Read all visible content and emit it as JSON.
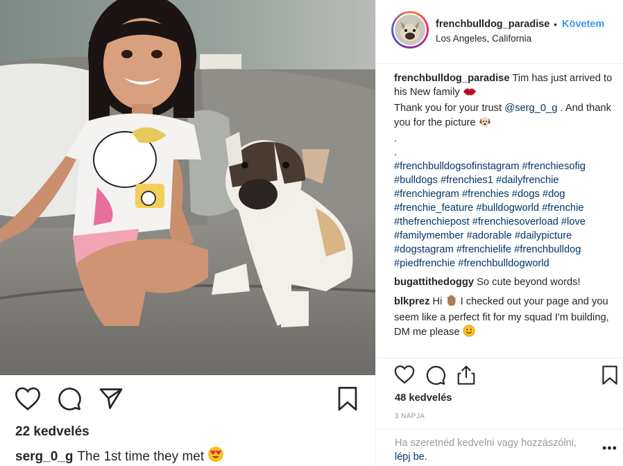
{
  "photo": {
    "alt": ""
  },
  "feed": {
    "likes": "22 kedvelés",
    "caption_user": "serg_0_g",
    "caption_text": "The 1st time they met",
    "icons": [
      "heart-icon",
      "comment-icon",
      "share-icon",
      "bookmark-icon"
    ]
  },
  "post": {
    "username": "frenchbulldog_paradise",
    "separator": "•",
    "follow_label": "Követem",
    "location": "Los Angeles, California",
    "caption": {
      "user": "frenchbulldog_paradise",
      "text1": "Tim has just arrived to his New family",
      "text2": "Thank you for your trust",
      "mention": "@serg_0_g",
      "text3": ". And thank you for the picture",
      "dot1": ".",
      "dot2": ".",
      "hashtags": "#frenchbulldogsofinstagram #frenchiesofig #bulldogs #frenchies1 #dailyfrenchie #frenchiegram #frenchies #dogs #dog #frenchie_feature #bulldogworld #frenchie #thefrenchiepost #frenchiesoverload #love #familymember #adorable #dailypicture #dogstagram #frenchielife #frenchbulldog #piedfrenchie #frenchbulldogworld"
    },
    "comments": [
      {
        "user": "bugattithedoggy",
        "text": "So cute beyond words!"
      },
      {
        "user": "blkprez",
        "text1": "Hi",
        "text2": "I checked out your page and you seem like a perfect fit for my squad I'm building, DM me please"
      }
    ],
    "likes": "48 kedvelés",
    "time": "3 NAPJA",
    "login_prompt_text": "Ha szeretnéd kedvelni vagy hozzászólni,",
    "login_link": "lépj be.",
    "more": "•••"
  },
  "colors": {
    "link_blue": "#3897f0",
    "hashtag": "#003569",
    "muted": "#999999",
    "text": "#262626"
  }
}
